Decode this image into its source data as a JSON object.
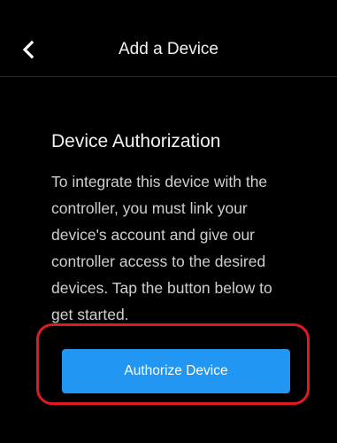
{
  "header": {
    "title": "Add a Device",
    "back_icon": "chevron-left-icon"
  },
  "content": {
    "section_title": "Device Authorization",
    "description_lines": [
      "To integrate this device with the",
      "controller, you must link your",
      "device's account and give our",
      "controller access to the desired",
      "devices. Tap the button below to",
      "get started."
    ]
  },
  "actions": {
    "authorize_label": "Authorize Device"
  },
  "colors": {
    "background": "#000000",
    "button": "#2196f3",
    "highlight": "#e01a22"
  }
}
